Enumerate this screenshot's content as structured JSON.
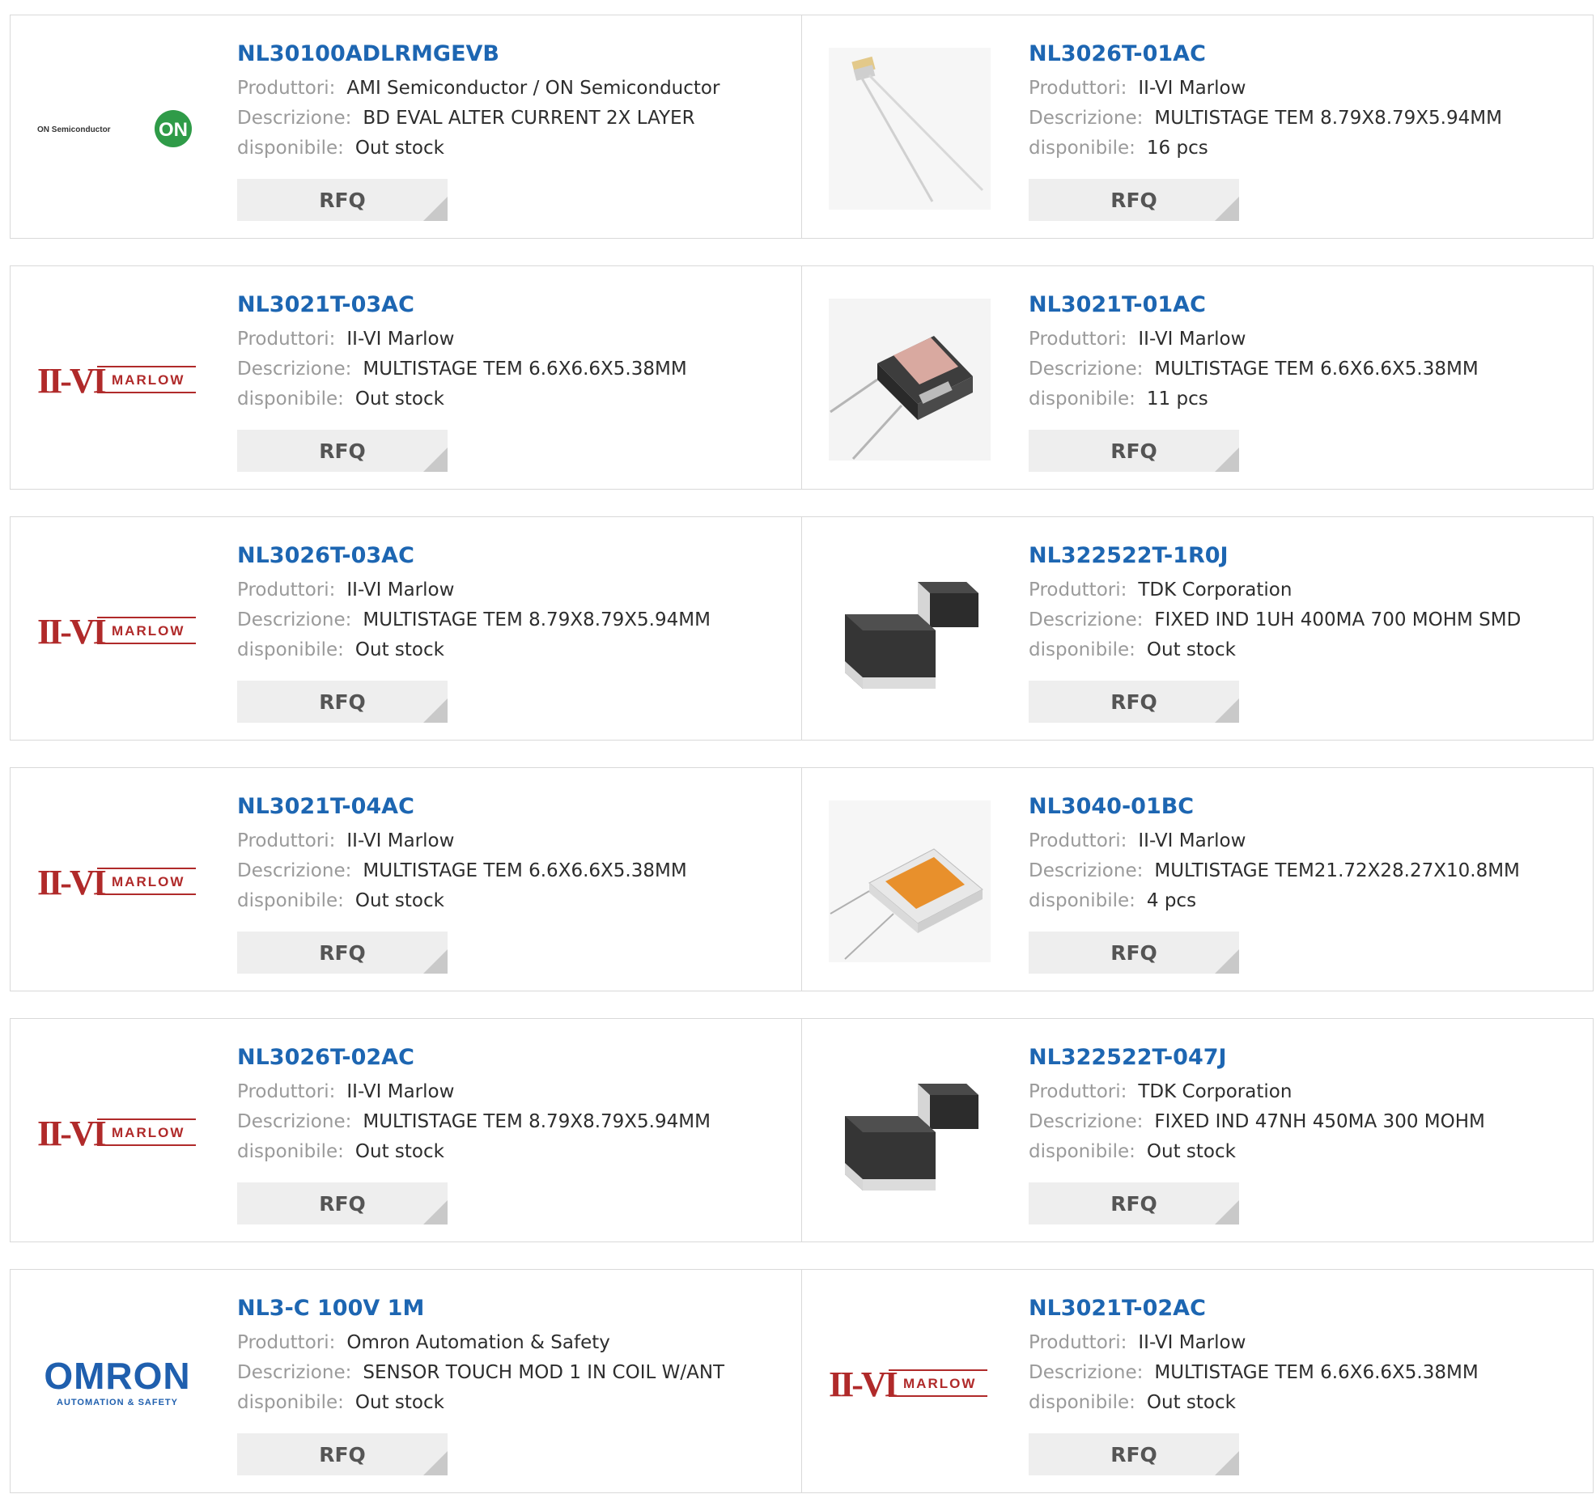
{
  "labels": {
    "manufacturer": "Produttori:",
    "description": "Descrizione:",
    "availability": "disponibile:",
    "rfq": "RFQ"
  },
  "logos": {
    "on_semi_text": "ON Semiconductor",
    "on_badge": "ON",
    "iivi": "II-VI",
    "marlow": "MARLOW",
    "omron": "OMRON",
    "omron_sub": "AUTOMATION & SAFETY"
  },
  "colors": {
    "link": "#1d66b2",
    "label": "#9a9a9a",
    "value": "#2d2d2d",
    "border": "#d9d9d9",
    "button_bg": "#eeeeee",
    "iivi_red": "#b02a2a",
    "omron_blue": "#1f5fae",
    "on_green": "#2f9b48"
  },
  "products": [
    {
      "part": "NL30100ADLRMGEVB",
      "manufacturer": "AMI Semiconductor / ON Semiconductor",
      "description": "BD EVAL ALTER CURRENT 2X LAYER",
      "availability": "Out stock",
      "image": "on-semiconductor-logo"
    },
    {
      "part": "NL3026T-01AC",
      "manufacturer": "II-VI Marlow",
      "description": "MULTISTAGE TEM 8.79X8.79X5.94MM",
      "availability": "16 pcs",
      "image": "tem-module-wires-photo"
    },
    {
      "part": "NL3021T-03AC",
      "manufacturer": "II-VI Marlow",
      "description": "MULTISTAGE TEM 6.6X6.6X5.38MM",
      "availability": "Out stock",
      "image": "iivi-marlow-logo"
    },
    {
      "part": "NL3021T-01AC",
      "manufacturer": "II-VI Marlow",
      "description": "MULTISTAGE TEM 6.6X6.6X5.38MM",
      "availability": "11 pcs",
      "image": "tem-cube-photo"
    },
    {
      "part": "NL3026T-03AC",
      "manufacturer": "II-VI Marlow",
      "description": "MULTISTAGE TEM 8.79X8.79X5.94MM",
      "availability": "Out stock",
      "image": "iivi-marlow-logo"
    },
    {
      "part": "NL322522T-1R0J",
      "manufacturer": "TDK Corporation",
      "description": "FIXED IND 1UH 400MA 700 MOHM SMD",
      "availability": "Out stock",
      "image": "smd-inductor-photo"
    },
    {
      "part": "NL3021T-04AC",
      "manufacturer": "II-VI Marlow",
      "description": "MULTISTAGE TEM 6.6X6.6X5.38MM",
      "availability": "Out stock",
      "image": "iivi-marlow-logo"
    },
    {
      "part": "NL3040-01BC",
      "manufacturer": "II-VI Marlow",
      "description": "MULTISTAGE TEM21.72X28.27X10.8MM",
      "availability": "4 pcs",
      "image": "tem-orange-module-photo"
    },
    {
      "part": "NL3026T-02AC",
      "manufacturer": "II-VI Marlow",
      "description": "MULTISTAGE TEM 8.79X8.79X5.94MM",
      "availability": "Out stock",
      "image": "iivi-marlow-logo"
    },
    {
      "part": "NL322522T-047J",
      "manufacturer": "TDK Corporation",
      "description": "FIXED IND 47NH 450MA 300 MOHM",
      "availability": "Out stock",
      "image": "smd-inductor-photo"
    },
    {
      "part": "NL3-C 100V 1M",
      "manufacturer": "Omron Automation & Safety",
      "description": "SENSOR TOUCH MOD 1 IN COIL W/ANT",
      "availability": "Out stock",
      "image": "omron-logo"
    },
    {
      "part": "NL3021T-02AC",
      "manufacturer": "II-VI Marlow",
      "description": "MULTISTAGE TEM 6.6X6.6X5.38MM",
      "availability": "Out stock",
      "image": "iivi-marlow-logo"
    }
  ]
}
